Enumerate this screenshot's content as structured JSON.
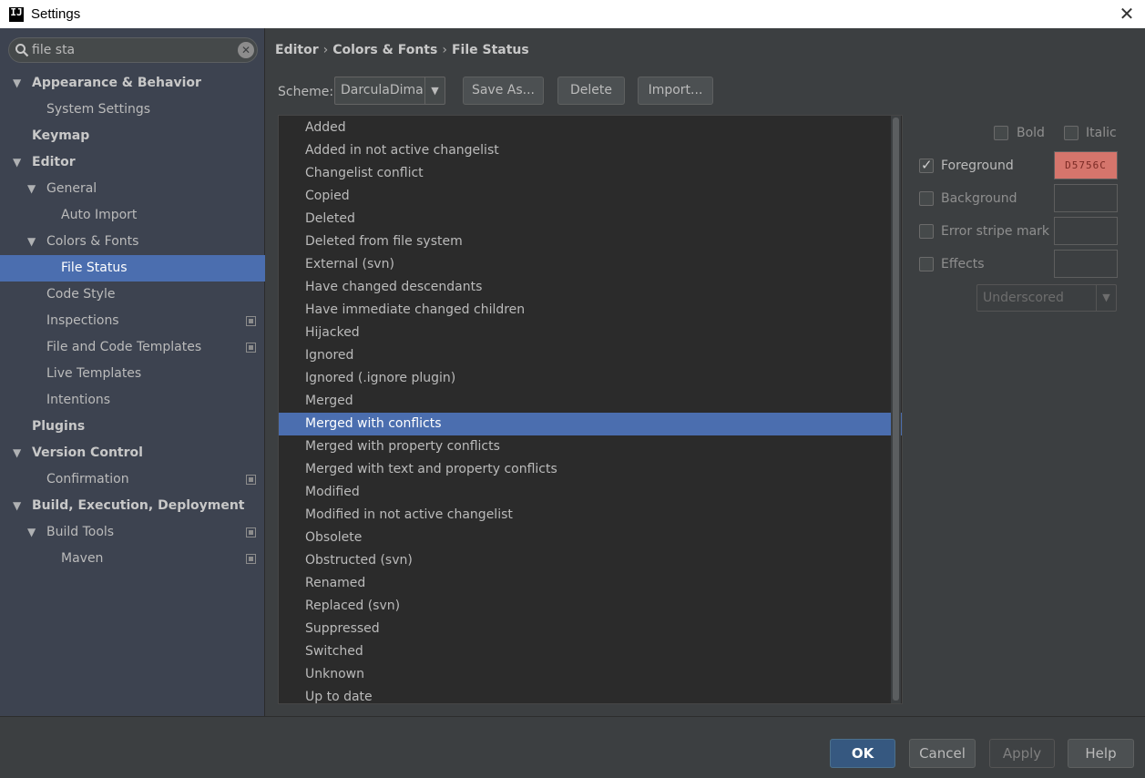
{
  "window": {
    "title": "Settings",
    "app_icon_text": "IJ",
    "close_glyph": "✕"
  },
  "search": {
    "value": "file sta",
    "clear_glyph": "✕"
  },
  "tree": [
    {
      "label": "Appearance & Behavior",
      "bold": true,
      "expanded": true
    },
    {
      "label": "System Settings"
    },
    {
      "label": "Keymap",
      "bold": true
    },
    {
      "label": "Editor",
      "bold": true,
      "expanded": true
    },
    {
      "label": "General",
      "expanded": true
    },
    {
      "label": "Auto Import"
    },
    {
      "label": "Colors & Fonts",
      "expanded": true
    },
    {
      "label": "File Status",
      "selected": true
    },
    {
      "label": "Code Style"
    },
    {
      "label": "Inspections",
      "project_icon": true
    },
    {
      "label": "File and Code Templates",
      "project_icon": true
    },
    {
      "label": "Live Templates"
    },
    {
      "label": "Intentions"
    },
    {
      "label": "Plugins",
      "bold": true
    },
    {
      "label": "Version Control",
      "bold": true,
      "expanded": true
    },
    {
      "label": "Confirmation",
      "project_icon": true
    },
    {
      "label": "Build, Execution, Deployment",
      "bold": true,
      "expanded": true
    },
    {
      "label": "Build Tools",
      "expanded": true,
      "project_icon": true
    },
    {
      "label": "Maven",
      "project_icon": true
    }
  ],
  "breadcrumb": [
    "Editor",
    "Colors & Fonts",
    "File Status"
  ],
  "breadcrumb_sep": "›",
  "scheme": {
    "label": "Scheme:",
    "value": "DarculaDima",
    "dropdown_glyph": "▼"
  },
  "buttons": {
    "save_as": "Save As...",
    "delete": "Delete",
    "import": "Import..."
  },
  "file_statuses": [
    "Added",
    "Added in not active changelist",
    "Changelist conflict",
    "Copied",
    "Deleted",
    "Deleted from file system",
    "External (svn)",
    "Have changed descendants",
    "Have immediate changed children",
    "Hijacked",
    "Ignored",
    "Ignored (.ignore plugin)",
    "Merged",
    "Merged with conflicts",
    "Merged with property conflicts",
    "Merged with text and property conflicts",
    "Modified",
    "Modified in not active changelist",
    "Obsolete",
    "Obstructed (svn)",
    "Renamed",
    "Replaced (svn)",
    "Suppressed",
    "Switched",
    "Unknown",
    "Up to date"
  ],
  "selected_status": "Merged with conflicts",
  "attributes": {
    "bold": {
      "label": "Bold",
      "checked": false
    },
    "italic": {
      "label": "Italic",
      "checked": false
    },
    "foreground": {
      "label": "Foreground",
      "checked": true,
      "color": "D5756C",
      "color_hex": "#d5756c"
    },
    "background": {
      "label": "Background",
      "checked": false
    },
    "error_stripe": {
      "label": "Error stripe mark",
      "checked": false
    },
    "effects": {
      "label": "Effects",
      "checked": false
    },
    "effect_type": {
      "value": "Underscored",
      "dropdown_glyph": "▼"
    }
  },
  "footer": {
    "ok": "OK",
    "cancel": "Cancel",
    "apply": "Apply",
    "help": "Help"
  },
  "colors": {
    "selection": "#4b6eaf",
    "sidebar_bg": "#3d4350",
    "panel_bg": "#3c3f41",
    "list_bg": "#2b2b2b",
    "primary_button": "#365880"
  }
}
